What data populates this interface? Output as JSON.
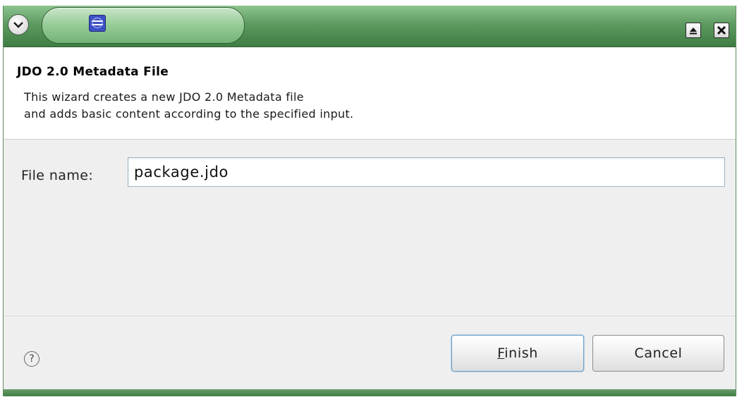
{
  "dialog": {
    "title": "JDO 2.0 Metadata File",
    "description_line1": "This wizard creates a new JDO 2.0 Metadata file",
    "description_line2": "and adds basic content according to the specified input."
  },
  "form": {
    "file_name_label": "File name:",
    "file_name_value": "package.jdo"
  },
  "buttons": {
    "finish_mnemonic": "F",
    "finish_rest": "inish",
    "cancel_label": "Cancel",
    "help_symbol": "?"
  },
  "icons": {
    "window_menu": "chevron-down-icon",
    "app": "eclipse-icon",
    "maximize": "maximize-icon",
    "close": "close-icon",
    "help": "help-icon"
  },
  "colors": {
    "titlebar": "#5d9a60",
    "finish_border": "#6f9ec2"
  }
}
